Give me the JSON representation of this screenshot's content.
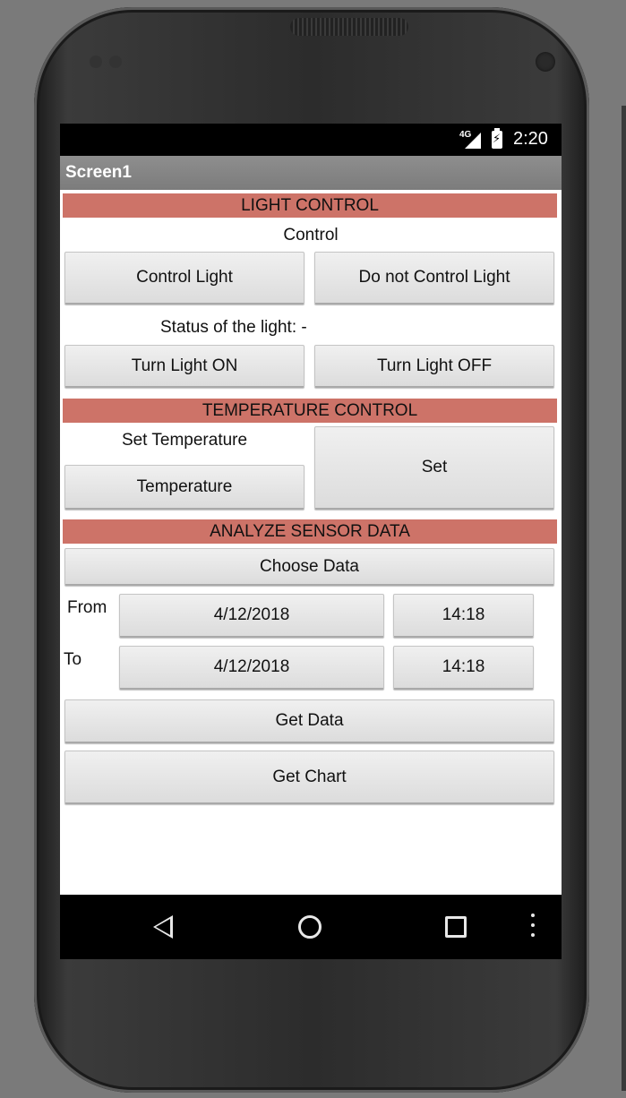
{
  "status_bar": {
    "network": "4G",
    "time": "2:20"
  },
  "app": {
    "title": "Screen1"
  },
  "light_section": {
    "header": "LIGHT CONTROL",
    "control_label": "Control",
    "control_button": "Control Light",
    "no_control_button": "Do not Control Light",
    "status_text": "Status of the light: -",
    "on_button": "Turn Light ON",
    "off_button": "Turn Light OFF"
  },
  "temperature_section": {
    "header": "TEMPERATURE CONTROL",
    "set_label": "Set Temperature",
    "temperature_button": "Temperature",
    "set_button": "Set"
  },
  "sensor_section": {
    "header": "ANALYZE SENSOR DATA",
    "choose_button": "Choose Data",
    "from_label": "From",
    "from_date": "4/12/2018",
    "from_time": "14:18",
    "to_label": "To",
    "to_date": "4/12/2018",
    "to_time": "14:18",
    "get_data_button": "Get Data",
    "get_chart_button": "Get Chart"
  },
  "nav_icons": [
    "back-icon",
    "home-icon",
    "recent-apps-icon",
    "overflow-menu-icon"
  ]
}
